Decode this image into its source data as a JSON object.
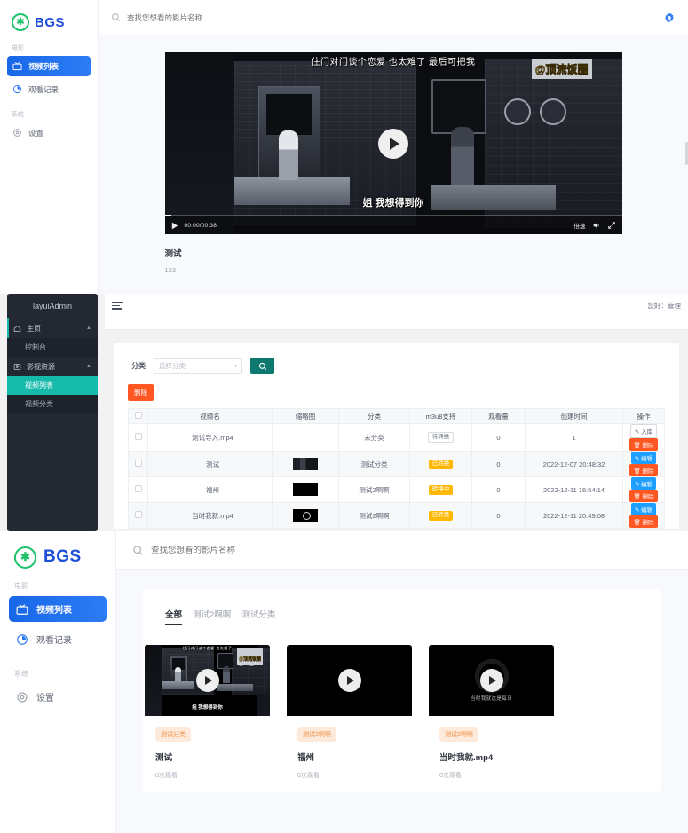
{
  "frontend_player": {
    "brand": {
      "logo_icon": "flower-badge-icon",
      "name": "BGS"
    },
    "sidebar": {
      "sections": [
        {
          "title": "电影",
          "items": [
            {
              "label": "视频列表",
              "icon": "tv-icon",
              "active": true
            },
            {
              "label": "观看记录",
              "icon": "pie-clock-icon",
              "active": false
            }
          ]
        },
        {
          "title": "系统",
          "items": [
            {
              "label": "设置",
              "icon": "gear-icon",
              "active": false
            }
          ]
        }
      ]
    },
    "topbar": {
      "search_icon": "search-icon",
      "search_placeholder": "查找您想看的影片名称",
      "search_value": "",
      "settings_icon": "gear-icon"
    },
    "player": {
      "subtitle_top": "住门对门谈个恋爱 也太难了 最后可把我",
      "watermark": "@顶流饭圈",
      "subtitle_bottom": "姐 我想得到你",
      "play_icon": "play-icon",
      "current_time": "00:00",
      "duration": "00:38",
      "time_display": "00:00/00:38",
      "rate_label": "倍速",
      "volume_icon": "volume-icon",
      "fullscreen_icon": "fullscreen-icon",
      "progress_percent": 1.5
    },
    "video": {
      "title": "测试",
      "description": "123"
    }
  },
  "admin": {
    "sidebar": {
      "logo": "layuiAdmin",
      "groups": [
        {
          "label": "主页",
          "icon": "home-icon",
          "expanded": true,
          "chevron": "▲",
          "children": [
            {
              "label": "控制台",
              "active": false
            }
          ]
        },
        {
          "label": "影视资源",
          "icon": "media-icon",
          "expanded": true,
          "chevron": "▲",
          "children": [
            {
              "label": "视频列表",
              "active": true
            },
            {
              "label": "视频分类",
              "active": false
            }
          ]
        }
      ]
    },
    "header": {
      "menu_icon": "hamburger-icon",
      "greeting": "您好：管理"
    },
    "filter": {
      "category_label": "分类",
      "category_placeholder": "选择分类",
      "category_value": "",
      "search_icon": "search-icon",
      "delete_label": "删除"
    },
    "table": {
      "columns": [
        "",
        "视频名",
        "缩略图",
        "分类",
        "m3u8支持",
        "观看量",
        "创建时间",
        "操作"
      ],
      "rows": [
        {
          "name": "测试导入.mp4",
          "thumb": "none",
          "category": "未分类",
          "m3u8": "待转换",
          "m3u8_state": "pending",
          "views": "0",
          "created": "1",
          "actions": [
            {
              "label": "入库",
              "kind": "store"
            },
            {
              "label": "删除",
              "kind": "del"
            }
          ]
        },
        {
          "name": "测试",
          "thumb": "scene",
          "category": "测试分类",
          "m3u8": "已转换",
          "m3u8_state": "done",
          "views": "0",
          "created": "2022-12-07 20:48:32",
          "actions": [
            {
              "label": "编辑",
              "kind": "edit"
            },
            {
              "label": "删除",
              "kind": "del"
            }
          ]
        },
        {
          "name": "福州",
          "thumb": "black",
          "category": "测试2啊啊",
          "m3u8": "转换中",
          "m3u8_state": "running",
          "views": "0",
          "created": "2022-12-11 16:54:14",
          "actions": [
            {
              "label": "编辑",
              "kind": "edit"
            },
            {
              "label": "删除",
              "kind": "del"
            }
          ]
        },
        {
          "name": "当时我就.mp4",
          "thumb": "ring",
          "category": "测试2啊啊",
          "m3u8": "已转换",
          "m3u8_state": "done",
          "views": "0",
          "created": "2022-12-11 20:49:08",
          "actions": [
            {
              "label": "编辑",
              "kind": "edit"
            },
            {
              "label": "删除",
              "kind": "del"
            }
          ]
        }
      ]
    },
    "colors": {
      "accent": "#16baaa",
      "search_btn": "#0e7a6f",
      "danger": "#ff5722",
      "edit": "#1e9fff",
      "badge": "#ffb800"
    }
  },
  "frontend_grid": {
    "brand": {
      "logo_icon": "flower-badge-icon",
      "name": "BGS"
    },
    "sidebar": {
      "sections": [
        {
          "title": "电影",
          "items": [
            {
              "label": "视频列表",
              "icon": "tv-icon",
              "active": true
            },
            {
              "label": "观看记录",
              "icon": "pie-clock-icon",
              "active": false
            }
          ]
        },
        {
          "title": "系统",
          "items": [
            {
              "label": "设置",
              "icon": "gear-icon",
              "active": false
            }
          ]
        }
      ]
    },
    "topbar": {
      "search_icon": "search-icon",
      "search_placeholder": "查找您想看的影片名称",
      "search_value": ""
    },
    "tabs": [
      {
        "label": "全部",
        "active": true
      },
      {
        "label": "测试2啊啊",
        "active": false
      },
      {
        "label": "测试分类",
        "active": false
      }
    ],
    "cards": [
      {
        "badge": "测试分类",
        "title": "测试",
        "views": "0次观看",
        "thumb": "scene",
        "subtitle_top": "住门对门谈个恋爱 也太难了",
        "watermark": "@顶流饭圈",
        "subtitle_bottom": "姐 我想得到你",
        "play_icon": "play-icon"
      },
      {
        "badge": "测试2啊啊",
        "title": "福州",
        "views": "0次观看",
        "thumb": "black",
        "play_icon": "play-icon"
      },
      {
        "badge": "测试2啊啊",
        "title": "当时我就.mp4",
        "views": "0次观看",
        "thumb": "ring",
        "caption": "当时我就这是每日",
        "play_icon": "play-icon"
      }
    ]
  },
  "theme": {
    "brand_blue": "#1d4ed8",
    "active_blue": "#2d7cf5",
    "logo_green": "#1fc16b",
    "badge_orange": "#f08b3c",
    "badge_bg": "#fdeadb"
  }
}
